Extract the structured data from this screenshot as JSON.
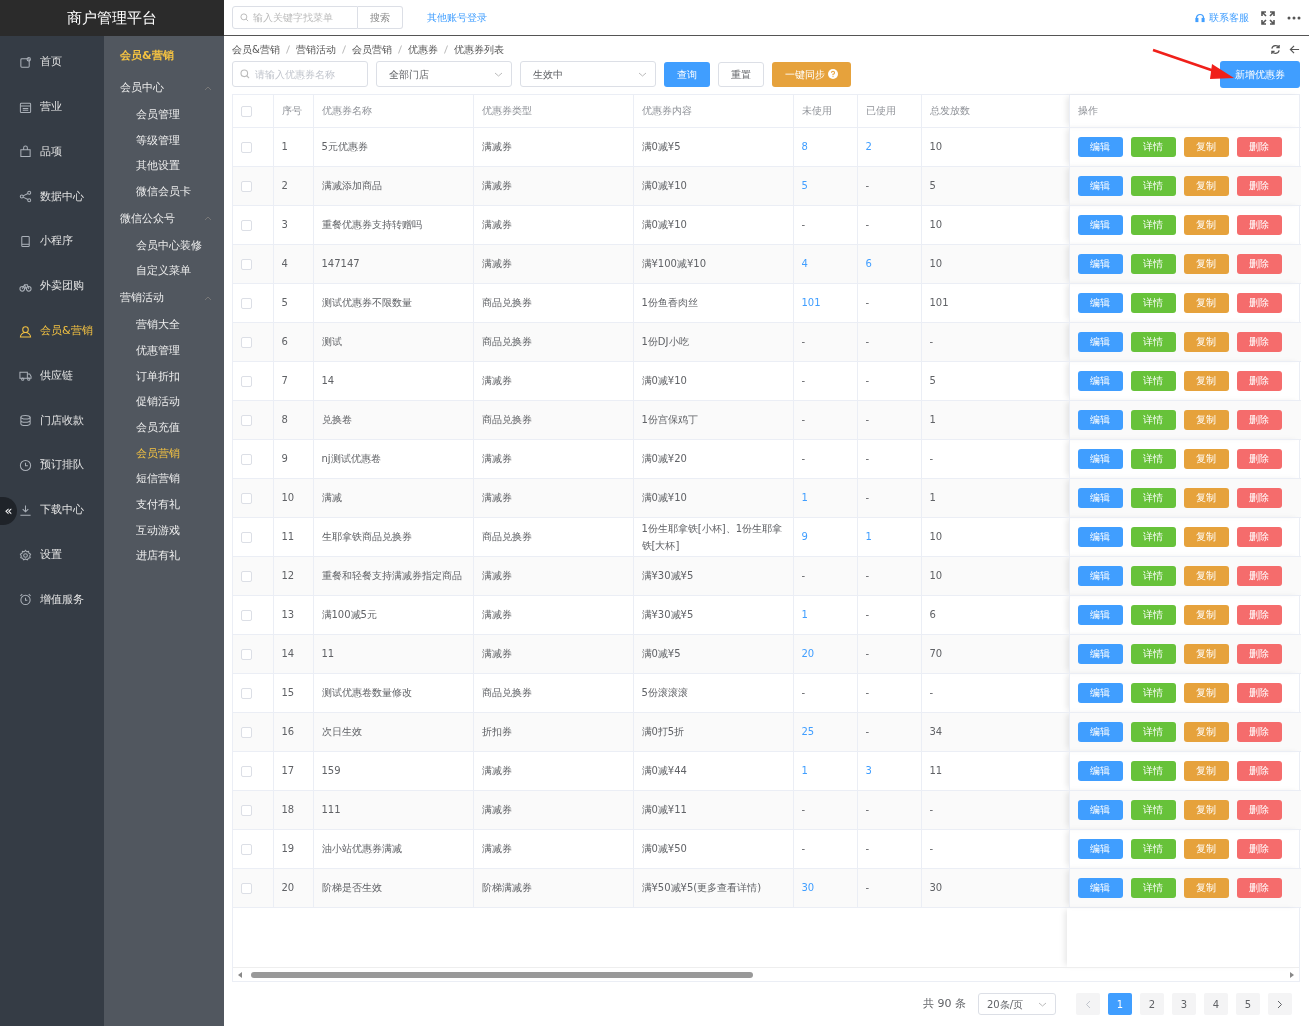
{
  "app_title": "商户管理平台",
  "sidebar": {
    "items": [
      {
        "label": "首页",
        "selected": false
      },
      {
        "label": "营业",
        "selected": false
      },
      {
        "label": "品项",
        "selected": false
      },
      {
        "label": "数据中心",
        "selected": false
      },
      {
        "label": "小程序",
        "selected": false
      },
      {
        "label": "外卖团购",
        "selected": false
      },
      {
        "label": "会员&营销",
        "selected": true
      },
      {
        "label": "供应链",
        "selected": false
      },
      {
        "label": "门店收款",
        "selected": false
      },
      {
        "label": "预订排队",
        "selected": false
      },
      {
        "label": "下载中心",
        "selected": false
      },
      {
        "label": "设置",
        "selected": false
      },
      {
        "label": "增值服务",
        "selected": false
      }
    ],
    "collapse_label": "«"
  },
  "subnav": {
    "title": "会员&营销",
    "groups": [
      {
        "label": "会员中心",
        "expanded": true,
        "children": [
          {
            "label": "会员管理",
            "selected": false
          },
          {
            "label": "等级管理",
            "selected": false
          },
          {
            "label": "其他设置",
            "selected": false
          },
          {
            "label": "微信会员卡",
            "selected": false
          }
        ]
      },
      {
        "label": "微信公众号",
        "expanded": true,
        "children": [
          {
            "label": "会员中心装修",
            "selected": false
          },
          {
            "label": "自定义菜单",
            "selected": false
          }
        ]
      },
      {
        "label": "营销活动",
        "expanded": true,
        "children": [
          {
            "label": "营销大全",
            "selected": false
          },
          {
            "label": "优惠管理",
            "selected": false
          },
          {
            "label": "订单折扣",
            "selected": false
          },
          {
            "label": "促销活动",
            "selected": false
          },
          {
            "label": "会员充值",
            "selected": false
          },
          {
            "label": "会员营销",
            "selected": true
          },
          {
            "label": "短信营销",
            "selected": false
          },
          {
            "label": "支付有礼",
            "selected": false
          },
          {
            "label": "互动游戏",
            "selected": false
          },
          {
            "label": "进店有礼",
            "selected": false
          }
        ]
      }
    ]
  },
  "topbar": {
    "search": {
      "placeholder": "输入关键字找菜单"
    },
    "search_button": "搜索",
    "link": "其他账号登录",
    "support": "联系客服"
  },
  "breadcrumb": [
    "会员&营销",
    "营销活动",
    "会员营销",
    "优惠券",
    "优惠券列表"
  ],
  "filters": {
    "name": {
      "placeholder": "请输入优惠券名称"
    },
    "store": "全部门店",
    "status": "生效中",
    "query_button": "查询",
    "reset_button": "重置",
    "sync_button": "一键同步",
    "add_button": "新增优惠券"
  },
  "table": {
    "select_all": {
      "checked": false
    },
    "columns": [
      "序号",
      "优惠券名称",
      "优惠券类型",
      "优惠券内容",
      "未使用",
      "已使用",
      "总发放数",
      "操作"
    ],
    "rows": [
      {
        "checked": false,
        "cells": [
          "1",
          "5元优惠券",
          "满减券",
          "满0减¥5"
        ],
        "unused": {
          "text": "8",
          "link": true
        },
        "used": {
          "text": "2",
          "link": true
        },
        "total": "10",
        "actions": [
          "编辑",
          "详情",
          "复制",
          "删除"
        ]
      },
      {
        "checked": false,
        "cells": [
          "2",
          "满减添加商品",
          "满减券",
          "满0减¥10"
        ],
        "unused": {
          "text": "5",
          "link": true
        },
        "used": {
          "text": "-",
          "link": false
        },
        "total": "5",
        "actions": [
          "编辑",
          "详情",
          "复制",
          "删除"
        ]
      },
      {
        "checked": false,
        "cells": [
          "3",
          "重餐优惠券支持转赠吗",
          "满减券",
          "满0减¥10"
        ],
        "unused": {
          "text": "-",
          "link": false
        },
        "used": {
          "text": "-",
          "link": false
        },
        "total": "10",
        "actions": [
          "编辑",
          "详情",
          "复制",
          "删除"
        ]
      },
      {
        "checked": false,
        "cells": [
          "4",
          "147147",
          "满减券",
          "满¥100减¥10"
        ],
        "unused": {
          "text": "4",
          "link": true
        },
        "used": {
          "text": "6",
          "link": true
        },
        "total": "10",
        "actions": [
          "编辑",
          "详情",
          "复制",
          "删除"
        ]
      },
      {
        "checked": false,
        "cells": [
          "5",
          "测试优惠券不限数量",
          "商品兑换券",
          "1份鱼香肉丝"
        ],
        "unused": {
          "text": "101",
          "link": true
        },
        "used": {
          "text": "-",
          "link": false
        },
        "total": "101",
        "actions": [
          "编辑",
          "详情",
          "复制",
          "删除"
        ]
      },
      {
        "checked": false,
        "cells": [
          "6",
          "测试",
          "商品兑换券",
          "1份DJ小吃"
        ],
        "unused": {
          "text": "-",
          "link": false
        },
        "used": {
          "text": "-",
          "link": false
        },
        "total": "-",
        "actions": [
          "编辑",
          "详情",
          "复制",
          "删除"
        ]
      },
      {
        "checked": false,
        "cells": [
          "7",
          "14",
          "满减券",
          "满0减¥10"
        ],
        "unused": {
          "text": "-",
          "link": false
        },
        "used": {
          "text": "-",
          "link": false
        },
        "total": "5",
        "actions": [
          "编辑",
          "详情",
          "复制",
          "删除"
        ]
      },
      {
        "checked": false,
        "cells": [
          "8",
          "兑换卷",
          "商品兑换券",
          "1份宫保鸡丁"
        ],
        "unused": {
          "text": "-",
          "link": false
        },
        "used": {
          "text": "-",
          "link": false
        },
        "total": "1",
        "actions": [
          "编辑",
          "详情",
          "复制",
          "删除"
        ]
      },
      {
        "checked": false,
        "cells": [
          "9",
          "nj测试优惠卷",
          "满减券",
          "满0减¥20"
        ],
        "unused": {
          "text": "-",
          "link": false
        },
        "used": {
          "text": "-",
          "link": false
        },
        "total": "-",
        "actions": [
          "编辑",
          "详情",
          "复制",
          "删除"
        ]
      },
      {
        "checked": false,
        "cells": [
          "10",
          "满减",
          "满减券",
          "满0减¥10"
        ],
        "unused": {
          "text": "1",
          "link": true
        },
        "used": {
          "text": "-",
          "link": false
        },
        "total": "1",
        "actions": [
          "编辑",
          "详情",
          "复制",
          "删除"
        ]
      },
      {
        "checked": false,
        "cells": [
          "11",
          "生耶拿铁商品兑换券",
          "商品兑换券",
          "1份生耶拿铁[小杯]、1份生耶拿铁[大杯]"
        ],
        "unused": {
          "text": "9",
          "link": true
        },
        "used": {
          "text": "1",
          "link": true
        },
        "total": "10",
        "actions": [
          "编辑",
          "详情",
          "复制",
          "删除"
        ]
      },
      {
        "checked": false,
        "cells": [
          "12",
          "重餐和轻餐支持满减券指定商品",
          "满减券",
          "满¥30减¥5"
        ],
        "unused": {
          "text": "-",
          "link": false
        },
        "used": {
          "text": "-",
          "link": false
        },
        "total": "10",
        "actions": [
          "编辑",
          "详情",
          "复制",
          "删除"
        ]
      },
      {
        "checked": false,
        "cells": [
          "13",
          "满100减5元",
          "满减券",
          "满¥30减¥5"
        ],
        "unused": {
          "text": "1",
          "link": true
        },
        "used": {
          "text": "-",
          "link": false
        },
        "total": "6",
        "actions": [
          "编辑",
          "详情",
          "复制",
          "删除"
        ]
      },
      {
        "checked": false,
        "cells": [
          "14",
          "11",
          "满减券",
          "满0减¥5"
        ],
        "unused": {
          "text": "20",
          "link": true
        },
        "used": {
          "text": "-",
          "link": false
        },
        "total": "70",
        "actions": [
          "编辑",
          "详情",
          "复制",
          "删除"
        ]
      },
      {
        "checked": false,
        "cells": [
          "15",
          "测试优惠卷数量修改",
          "商品兑换券",
          "5份滚滚滚"
        ],
        "unused": {
          "text": "-",
          "link": false
        },
        "used": {
          "text": "-",
          "link": false
        },
        "total": "-",
        "actions": [
          "编辑",
          "详情",
          "复制",
          "删除"
        ]
      },
      {
        "checked": false,
        "cells": [
          "16",
          "次日生效",
          "折扣券",
          "满0打5折"
        ],
        "unused": {
          "text": "25",
          "link": true
        },
        "used": {
          "text": "-",
          "link": false
        },
        "total": "34",
        "actions": [
          "编辑",
          "详情",
          "复制",
          "删除"
        ]
      },
      {
        "checked": false,
        "cells": [
          "17",
          "159",
          "满减券",
          "满0减¥44"
        ],
        "unused": {
          "text": "1",
          "link": true
        },
        "used": {
          "text": "3",
          "link": true
        },
        "total": "11",
        "actions": [
          "编辑",
          "详情",
          "复制",
          "删除"
        ]
      },
      {
        "checked": false,
        "cells": [
          "18",
          "111",
          "满减券",
          "满0减¥11"
        ],
        "unused": {
          "text": "-",
          "link": false
        },
        "used": {
          "text": "-",
          "link": false
        },
        "total": "-",
        "actions": [
          "编辑",
          "详情",
          "复制",
          "删除"
        ]
      },
      {
        "checked": false,
        "cells": [
          "19",
          "油小站优惠券满减",
          "满减券",
          "满0减¥50"
        ],
        "unused": {
          "text": "-",
          "link": false
        },
        "used": {
          "text": "-",
          "link": false
        },
        "total": "-",
        "actions": [
          "编辑",
          "详情",
          "复制",
          "删除"
        ]
      },
      {
        "checked": false,
        "cells": [
          "20",
          "阶梯是否生效",
          "阶梯满减券",
          "满¥50减¥5(更多查看详情)"
        ],
        "unused": {
          "text": "30",
          "link": true
        },
        "used": {
          "text": "-",
          "link": false
        },
        "total": "30",
        "actions": [
          "编辑",
          "详情",
          "复制",
          "删除"
        ]
      }
    ]
  },
  "pagination": {
    "total": "共 90 条",
    "page_size": "20条/页",
    "prev_disabled": true,
    "pages": [
      {
        "label": "1",
        "selected": true
      },
      {
        "label": "2",
        "selected": false
      },
      {
        "label": "3",
        "selected": false
      },
      {
        "label": "4",
        "selected": false
      },
      {
        "label": "5",
        "selected": false
      }
    ]
  }
}
